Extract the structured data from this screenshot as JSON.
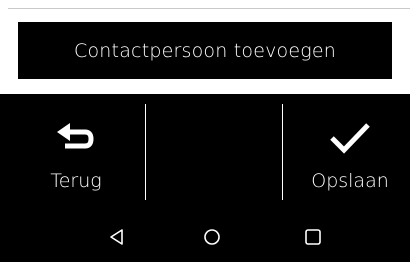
{
  "add_contact": {
    "label": "Contactpersoon toevoegen"
  },
  "actions": {
    "back": {
      "label": "Terug",
      "icon": "undo-arrow-icon"
    },
    "save": {
      "label": "Opslaan",
      "icon": "checkmark-icon"
    }
  },
  "nav_bar": {
    "buttons": [
      "back-triangle-icon",
      "home-circle-icon",
      "recents-square-icon"
    ]
  },
  "colors": {
    "background": "#ffffff",
    "bar": "#000000",
    "text": "#ffffff",
    "divider": "#c9c9c9"
  }
}
